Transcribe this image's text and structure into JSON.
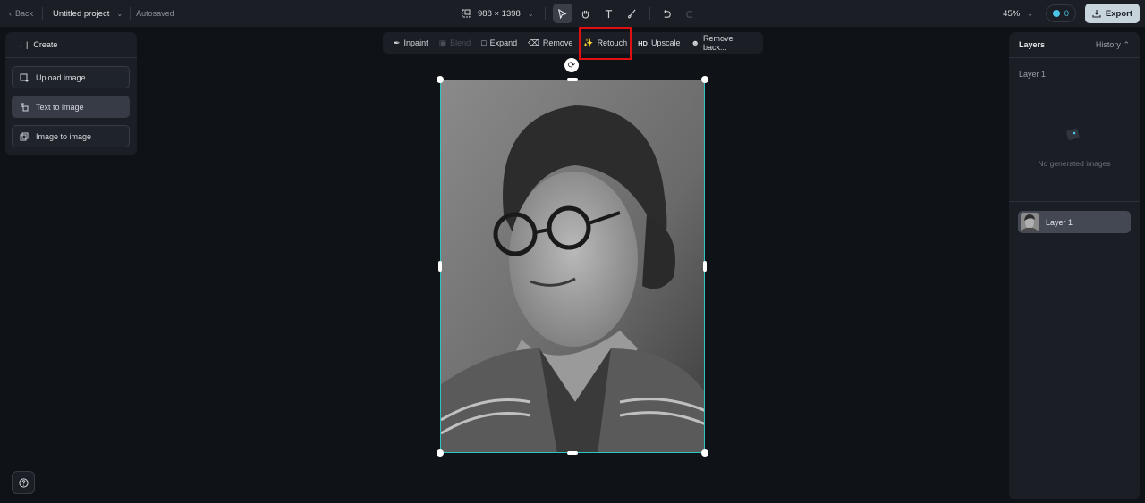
{
  "topbar": {
    "back_label": "Back",
    "project_name": "Untitled project",
    "save_status": "Autosaved",
    "canvas_size": "988 × 1398",
    "tools": [
      {
        "name": "select-tool",
        "icon": "cursor-icon",
        "active": true
      },
      {
        "name": "hand-tool",
        "icon": "hand-icon",
        "active": false
      },
      {
        "name": "text-tool",
        "icon": "text-icon",
        "active": false
      },
      {
        "name": "brush-tool",
        "icon": "brush-icon",
        "active": false
      },
      {
        "name": "undo",
        "icon": "undo-icon",
        "active": false
      },
      {
        "name": "redo",
        "icon": "redo-icon",
        "disabled": true
      }
    ],
    "zoom_level": "45%",
    "credits": "0",
    "export_label": "Export"
  },
  "left_panel": {
    "title": "Create",
    "items": [
      {
        "label": "Upload image",
        "icon": "upload-image-icon",
        "selected": false
      },
      {
        "label": "Text to image",
        "icon": "text-to-image-icon",
        "selected": true
      },
      {
        "label": "Image to image",
        "icon": "image-to-image-icon",
        "selected": false
      }
    ]
  },
  "context_toolbar": {
    "items": [
      {
        "label": "Inpaint",
        "icon": "inpaint-icon",
        "disabled": false
      },
      {
        "label": "Blend",
        "icon": "blend-icon",
        "disabled": true
      },
      {
        "label": "Expand",
        "icon": "expand-icon",
        "disabled": false
      },
      {
        "label": "Remove",
        "icon": "eraser-icon",
        "disabled": false
      },
      {
        "label": "Retouch",
        "icon": "magic-wand-icon",
        "disabled": false,
        "highlighted": true
      },
      {
        "label": "Upscale",
        "icon": "hd-icon",
        "icon_text": "HD",
        "disabled": false
      },
      {
        "label": "Remove back...",
        "icon": "remove-background-icon",
        "disabled": false
      }
    ]
  },
  "right_panel": {
    "title": "Layers",
    "history_label": "History",
    "layer_label": "Layer 1",
    "empty_text": "No generated images",
    "layers": [
      {
        "label": "Layer 1"
      }
    ]
  },
  "colors": {
    "accent_selection": "#2ec4c4",
    "highlight_box": "#e01010",
    "credits": "#4cc4e8",
    "export_bg": "#c8d4dc"
  }
}
